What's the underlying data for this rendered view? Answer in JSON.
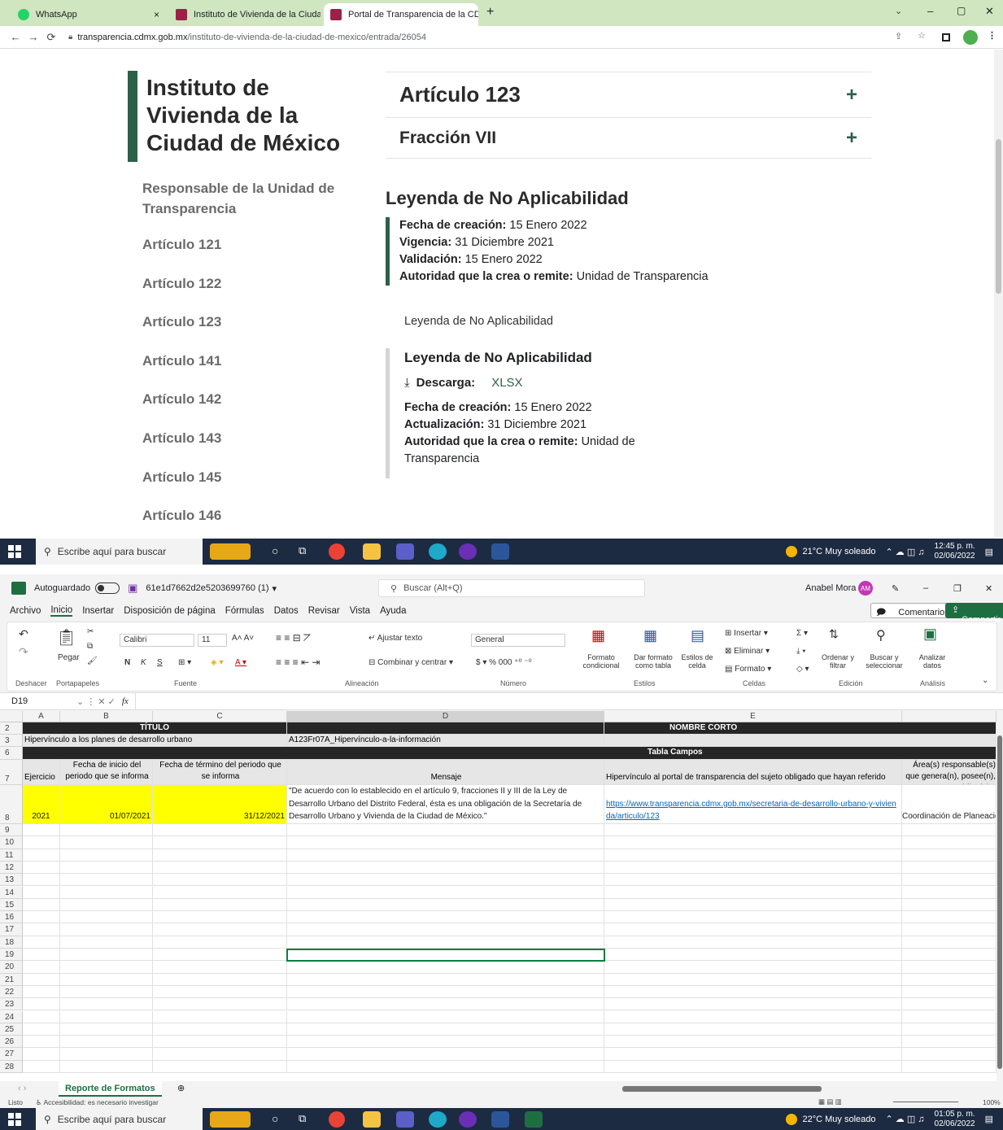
{
  "browser": {
    "tabs": [
      {
        "label": "WhatsApp",
        "close": "×"
      },
      {
        "label": "Instituto de Vivienda de la Ciuda",
        "close": "×"
      },
      {
        "label": "Portal de Transparencia de la CD",
        "close": "×"
      }
    ],
    "new_tab": "+",
    "url_domain": "transparencia.cdmx.gob.mx",
    "url_path": "/instituto-de-vivienda-de-la-ciudad-de-mexico/entrada/26054",
    "window_controls": {
      "minimize": "–",
      "maximize": "▢",
      "close": "✕"
    }
  },
  "page": {
    "institution": "Instituto de Vivienda de la Ciudad de México",
    "sidebar": [
      "Responsable de la Unidad de Transparencia",
      "Artículo 121",
      "Artículo 122",
      "Artículo 123",
      "Artículo 141",
      "Artículo 142",
      "Artículo 143",
      "Artículo 145",
      "Artículo 146"
    ],
    "accordion": [
      {
        "title": "Artículo 123",
        "icon": "+"
      },
      {
        "title": "Fracción VII",
        "icon": "+"
      }
    ],
    "leyenda_heading": "Leyenda de No Aplicabilidad",
    "meta": [
      {
        "label": "Fecha de creación:",
        "value": "15 Enero 2022"
      },
      {
        "label": "Vigencia:",
        "value": "31 Diciembre 2021"
      },
      {
        "label": "Validación:",
        "value": "15 Enero 2022"
      },
      {
        "label": "Autoridad que la crea o remite:",
        "value": "Unidad de Transparencia"
      }
    ],
    "plain_text": "Leyenda de No Aplicabilidad",
    "card": {
      "title": "Leyenda de No Aplicabilidad",
      "download_label": "Descarga:",
      "download_link": "XLSX",
      "meta": [
        {
          "label": "Fecha de creación:",
          "value": "15 Enero 2022"
        },
        {
          "label": "Actualización:",
          "value": "31 Diciembre 2021"
        },
        {
          "label": "Autoridad que la crea o remite:",
          "value": "Unidad de Transparencia"
        }
      ]
    }
  },
  "taskbar1": {
    "search_placeholder": "Escribe aquí para buscar",
    "weather": "21°C Muy soleado",
    "time": "12:45 p. m.",
    "date": "02/06/2022"
  },
  "excel": {
    "autosave": "Autoguardado",
    "filename": "61e1d7662d2e5203699760 (1)",
    "search": "Buscar (Alt+Q)",
    "user": "Anabel Mora",
    "user_initials": "AM",
    "menu": [
      "Archivo",
      "Inicio",
      "Insertar",
      "Disposición de página",
      "Fórmulas",
      "Datos",
      "Revisar",
      "Vista",
      "Ayuda"
    ],
    "comments_btn": "Comentarios",
    "share_btn": "Compartir",
    "ribbon": {
      "deshacer": "Deshacer",
      "pegar": "Pegar",
      "portapapeles": "Portapapeles",
      "font_name": "Calibri",
      "font_size": "11",
      "font_bold": "N",
      "font_italic": "K",
      "font_underline": "S",
      "fuente": "Fuente",
      "wrap": "Ajustar texto",
      "merge": "Combinar y centrar",
      "alineacion": "Alineación",
      "number_format": "General",
      "numero": "Número",
      "cond_format": "Formato condicional",
      "table_format": "Dar formato como tabla",
      "cell_styles": "Estilos de celda",
      "estilos": "Estilos",
      "insert": "Insertar",
      "delete": "Eliminar",
      "format": "Formato",
      "celdas": "Celdas",
      "sort": "Ordenar y filtrar",
      "find": "Buscar y seleccionar",
      "edicion": "Edición",
      "analyze": "Analizar datos",
      "analisis": "Análisis"
    },
    "name_box": "D19",
    "fx": "fx",
    "columns": [
      "A",
      "B",
      "C",
      "D",
      "E"
    ],
    "row_numbers": [
      "2",
      "3",
      "6",
      "7",
      "8",
      "9",
      "10",
      "11",
      "12",
      "13",
      "14",
      "15",
      "16",
      "17",
      "18",
      "19",
      "20",
      "21",
      "22",
      "23",
      "24",
      "25",
      "26",
      "27",
      "28"
    ],
    "cells": {
      "titulo": "TÍTULO",
      "nombre_corto": "NOMBRE CORTO",
      "r3_title": "Hipervínculo a los planes de desarrollo urbano",
      "r3_short": "A123Fr07A_Hipervínculo-a-la-información",
      "tabla_campos": "Tabla Campos",
      "h_ejercicio": "Ejercicio",
      "h_inicio": "Fecha de inicio del periodo que se informa",
      "h_termino": "Fecha de término del periodo que se informa",
      "h_mensaje": "Mensaje",
      "h_hiper": "Hipervínculo al portal de transparencia del sujeto obligado que hayan referido",
      "h_area": "Área(s) responsable(s) que genera(n), posee(n), publica(n) y",
      "v_ejercicio": "2021",
      "v_inicio": "01/07/2021",
      "v_termino": "31/12/2021",
      "v_mensaje": "\"De acuerdo con lo establecido en el artículo 9, fracciones II y III de la Ley de Desarrollo Urbano del Distrito Federal, ésta es una obligación de la Secretaría de Desarrollo Urbano y Vivienda de la  Ciudad de México.\"",
      "v_link": "https://www.transparencia.cdmx.gob.mx/secretaria-de-desarrollo-urbano-y-vivienda/articulo/123",
      "v_area": "Coordinación de Planeación"
    },
    "sheet_tab": "Reporte de Formatos",
    "status_ready": "Listo",
    "accessibility": "Accesibilidad: es necesario investigar",
    "zoom": "100%"
  },
  "taskbar2": {
    "search_placeholder": "Escribe aquí para buscar",
    "weather": "22°C Muy soleado",
    "time": "01:05 p. m.",
    "date": "02/06/2022"
  }
}
